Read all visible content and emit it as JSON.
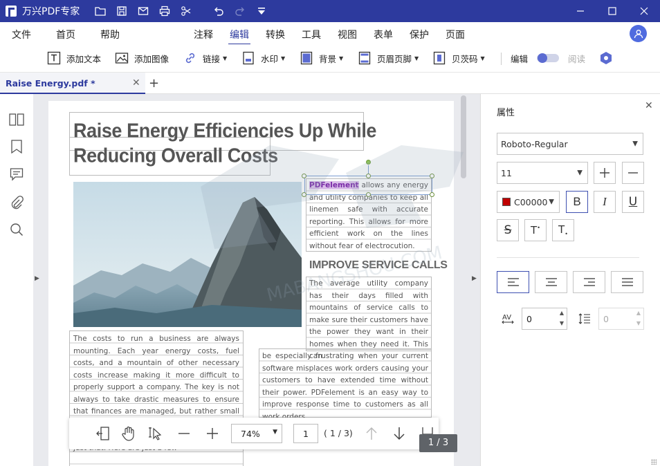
{
  "app": {
    "title": "万兴PDF专家"
  },
  "menu": {
    "file": "文件",
    "home": "首页",
    "help": "帮助",
    "comment": "注释",
    "edit": "编辑",
    "convert": "转换",
    "tools": "工具",
    "view": "视图",
    "form": "表单",
    "protect": "保护",
    "page": "页面"
  },
  "toolbar": {
    "add_text": "添加文本",
    "add_image": "添加图像",
    "link": "链接",
    "watermark": "水印",
    "background": "背景",
    "header_footer": "页眉页脚",
    "bates": "贝茨码",
    "edit_mode": "编辑",
    "read_mode": "阅读"
  },
  "tabs": [
    {
      "label": "Raise Energy.pdf *"
    }
  ],
  "document": {
    "title_line1": "Raise Energy Efficiencies Up While",
    "title_line2": "Reducing Overall Costs",
    "highlight_word": "PDFelement",
    "para1_rest": " allows any energy and utility companies to keep all linemen safe with accurate reporting. This allows for more efficient work on the lines without fear of electrocution.",
    "subhead": "IMPROVE SERVICE CALLS",
    "para2": "The average utility company has their days filled with mountains of service calls to make sure their customers have the power they want in their homes when they need it. This can",
    "para3": "be especially frustrating when your current software misplaces work orders causing your customers to have extended time without their power. PDFelement is an easy way to improve response time to customers as all work orders",
    "para4": "The costs to run a business are always mounting. Each year energy costs, fuel costs, and a mountain of other necessary costs increase making it more difficult to properly support a company. The key is not always to take drastic measures to ensure that finances are managed, but rather small entities that make a huge impact over time. PDFelement is the product to help you do just that. Here are just a few"
  },
  "bottom_toolbar": {
    "zoom": "74%",
    "page_input": "1",
    "page_total": "( 1 / 3)",
    "page_badge": "1 / 3"
  },
  "properties": {
    "title": "属性",
    "font": "Roboto-Regular",
    "size": "11",
    "color_label": "C00000",
    "color_hex": "#C00000",
    "char_spacing": "0",
    "line_spacing": "0"
  },
  "colors": {
    "brand": "#2d3a9e",
    "accent": "#4f6bdf"
  }
}
